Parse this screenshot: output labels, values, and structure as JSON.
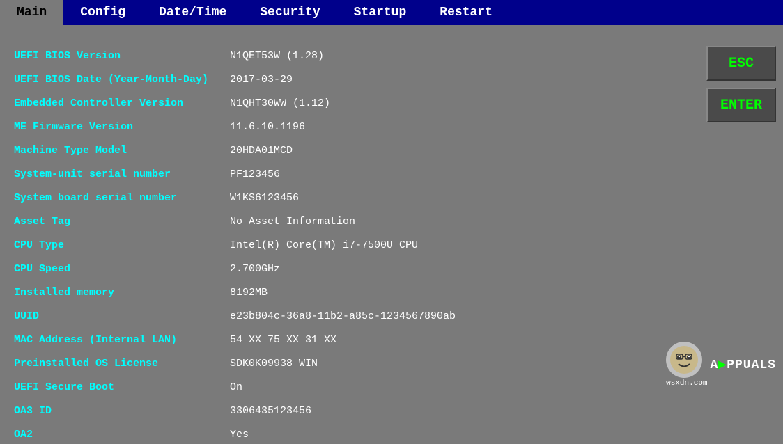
{
  "tabs": [
    {
      "id": "main",
      "label": "Main",
      "active": true
    },
    {
      "id": "config",
      "label": "Config",
      "active": false
    },
    {
      "id": "datetime",
      "label": "Date/Time",
      "active": false
    },
    {
      "id": "security",
      "label": "Security",
      "active": false
    },
    {
      "id": "startup",
      "label": "Startup",
      "active": false
    },
    {
      "id": "restart",
      "label": "Restart",
      "active": false
    }
  ],
  "buttons": [
    {
      "id": "esc",
      "label": "ESC"
    },
    {
      "id": "enter",
      "label": "ENTER"
    }
  ],
  "info_rows": [
    {
      "label": "UEFI BIOS Version",
      "value": "N1QET53W (1.28)"
    },
    {
      "label": "UEFI BIOS Date (Year-Month-Day)",
      "value": "2017-03-29"
    },
    {
      "label": "Embedded Controller Version",
      "value": "N1QHT30WW (1.12)"
    },
    {
      "label": "ME Firmware Version",
      "value": "11.6.10.1196"
    },
    {
      "label": "Machine Type Model",
      "value": "20HDA01MCD"
    },
    {
      "label": "System-unit serial number",
      "value": "PF123456"
    },
    {
      "label": "System board serial number",
      "value": "W1KS6123456"
    },
    {
      "label": "Asset Tag",
      "value": "No Asset Information"
    },
    {
      "label": "CPU Type",
      "value": "Intel(R) Core(TM) i7-7500U CPU"
    },
    {
      "label": "CPU Speed",
      "value": "2.700GHz"
    },
    {
      "label": "Installed memory",
      "value": "8192MB"
    },
    {
      "label": "UUID",
      "value": "e23b804c-36a8-11b2-a85c-1234567890ab"
    },
    {
      "label": "MAC Address (Internal LAN)",
      "value": "54 XX 75 XX 31 XX"
    },
    {
      "label": "Preinstalled OS License",
      "value": "SDK0K09938 WIN"
    },
    {
      "label": "UEFI Secure Boot",
      "value": "On"
    },
    {
      "label": "OA3 ID",
      "value": "3306435123456"
    },
    {
      "label": "OA2",
      "value": "Yes"
    }
  ],
  "watermark": {
    "text": "A▶PPUALS",
    "subtext": "wsxdn.com"
  }
}
